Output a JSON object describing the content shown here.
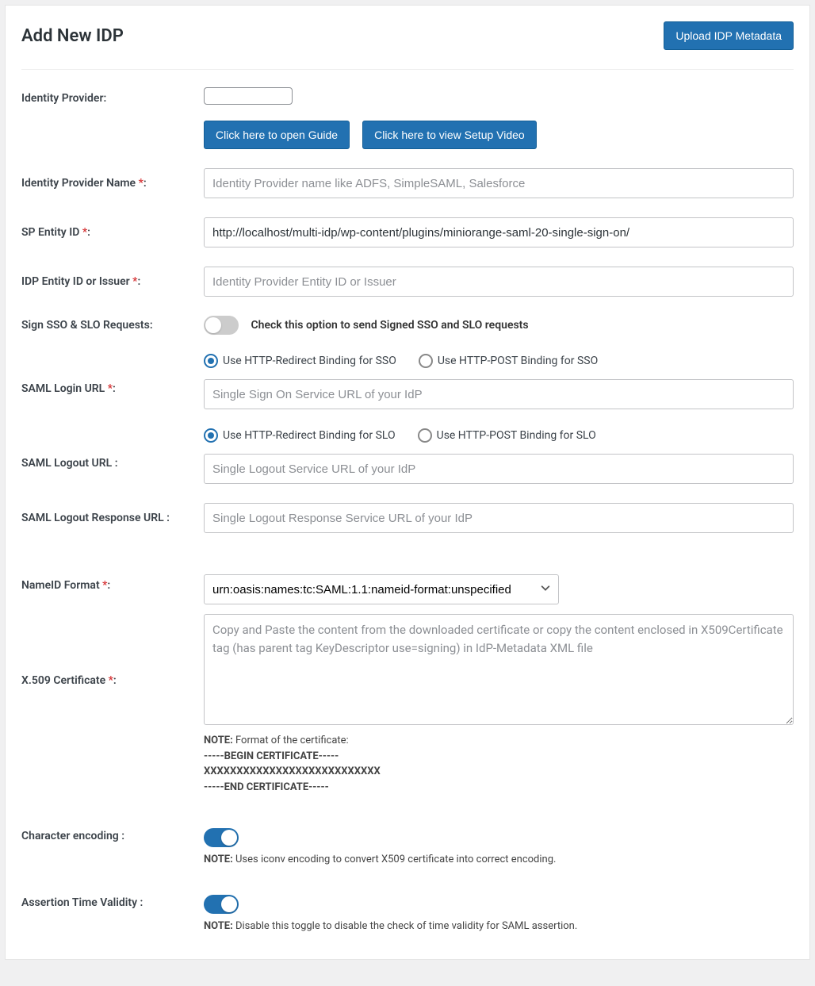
{
  "header": {
    "title": "Add New IDP",
    "upload_btn": "Upload IDP Metadata"
  },
  "fields": {
    "identity_provider": {
      "label": "Identity Provider:",
      "open_guide_btn": "Click here to open Guide",
      "view_video_btn": "Click here to view Setup Video"
    },
    "idp_name": {
      "label": "Identity Provider Name ",
      "placeholder": "Identity Provider name like ADFS, SimpleSAML, Salesforce"
    },
    "sp_entity": {
      "label": "SP Entity ID ",
      "value": "http://localhost/multi-idp/wp-content/plugins/miniorange-saml-20-single-sign-on/"
    },
    "idp_entity": {
      "label": "IDP Entity ID or Issuer ",
      "placeholder": "Identity Provider Entity ID or Issuer"
    },
    "sign_requests": {
      "label": "Sign SSO & SLO Requests:",
      "text": "Check this option to send Signed SSO and SLO requests"
    },
    "login_url": {
      "label": "SAML Login URL ",
      "radio_redirect": "Use HTTP-Redirect Binding for SSO",
      "radio_post": "Use HTTP-POST Binding for SSO",
      "placeholder": "Single Sign On Service URL of your IdP"
    },
    "logout_url": {
      "label": "SAML Logout URL :",
      "radio_redirect": "Use HTTP-Redirect Binding for SLO",
      "radio_post": "Use HTTP-POST Binding for SLO",
      "placeholder": "Single Logout Service URL of your IdP"
    },
    "logout_response": {
      "label": "SAML Logout Response URL :",
      "placeholder": "Single Logout Response Service URL of your IdP"
    },
    "nameid": {
      "label": "NameID Format ",
      "selected": "urn:oasis:names:tc:SAML:1.1:nameid-format:unspecified"
    },
    "cert": {
      "label": "X.509 Certificate ",
      "placeholder": "Copy and Paste the content from the downloaded certificate or copy the content enclosed in X509Certificate tag (has parent tag KeyDescriptor use=signing) in IdP-Metadata XML file",
      "note_label": "NOTE:",
      "note_line1": " Format of the certificate:",
      "note_line2": "-----BEGIN CERTIFICATE-----",
      "note_line3": "XXXXXXXXXXXXXXXXXXXXXXXXXXX",
      "note_line4": "-----END CERTIFICATE-----"
    },
    "char_encoding": {
      "label": "Character encoding :",
      "note_label": "NOTE:",
      "note_text": " Uses iconv encoding to convert X509 certificate into correct encoding."
    },
    "assertion": {
      "label": "Assertion Time Validity :",
      "note_label": "NOTE:",
      "note_text": " Disable this toggle to disable the check of time validity for SAML assertion."
    }
  }
}
